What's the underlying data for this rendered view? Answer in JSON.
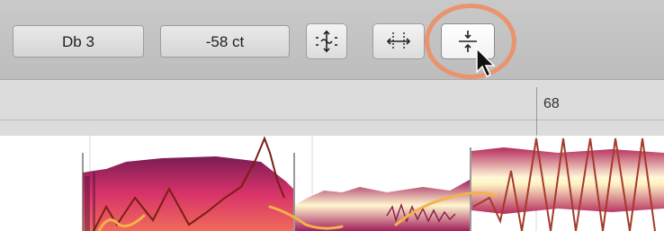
{
  "toolbar": {
    "pitch_value": "Db 3",
    "cents_value": "-58 ct",
    "tools": [
      {
        "name": "pitch-center-tool",
        "icon": "pitch-center-icon",
        "active": false
      },
      {
        "name": "pitch-drift-tool",
        "icon": "pitch-drift-icon",
        "active": false
      },
      {
        "name": "pitch-modulation-tool",
        "icon": "pitch-modulation-icon",
        "active": true
      }
    ]
  },
  "ruler": {
    "bar_number": "68"
  },
  "colors": {
    "highlight": "#e9946e",
    "blob_dark": "#b4245c",
    "blob_light": "#fff3c4",
    "pitch_curve": "#7a1f12"
  }
}
